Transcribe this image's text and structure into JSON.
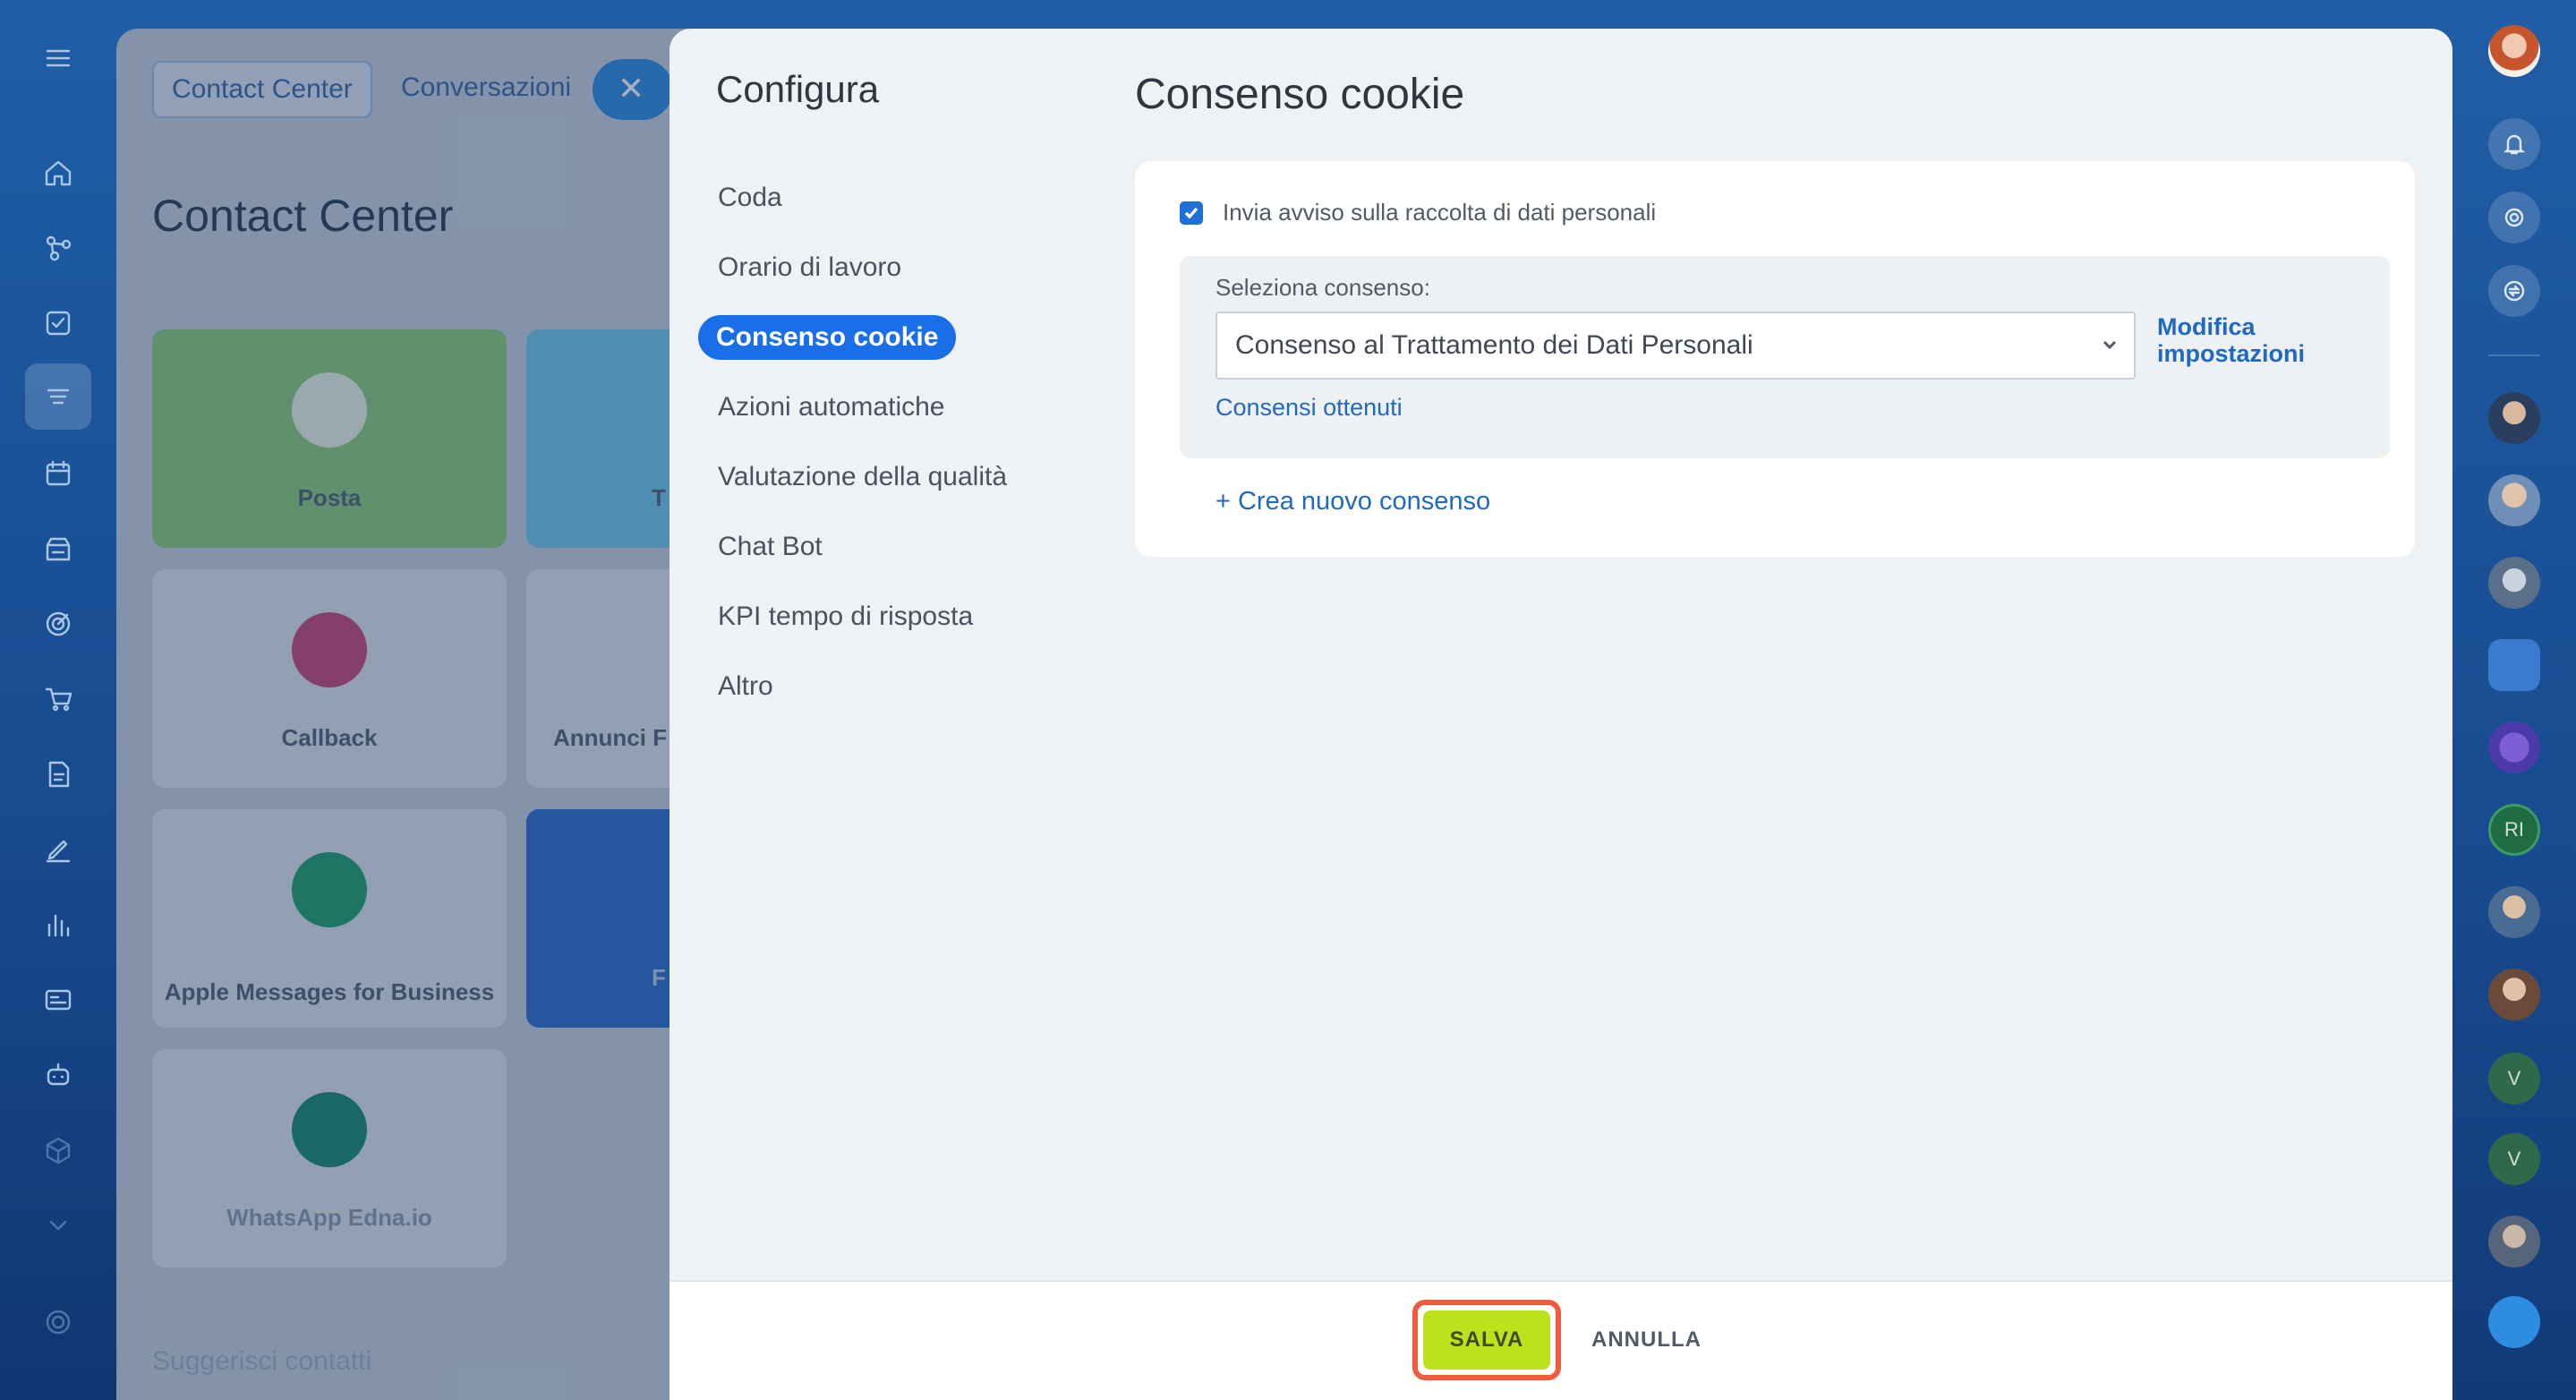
{
  "background_page": {
    "tabs": [
      "Contact Center",
      "Conversazioni"
    ],
    "close_label": "✕",
    "title": "Contact Center",
    "cards": [
      "Posta",
      "T",
      "Callback",
      "Annunci F",
      "Apple Messages for Business",
      "F",
      "WhatsApp Edna.io"
    ],
    "footer_text": "Suggerisci contatti"
  },
  "sidebar": {
    "title": "Configura",
    "items": [
      {
        "label": "Coda"
      },
      {
        "label": "Orario di lavoro"
      },
      {
        "label": "Consenso cookie",
        "active": true
      },
      {
        "label": "Azioni automatiche"
      },
      {
        "label": "Valutazione della qualità"
      },
      {
        "label": "Chat Bot"
      },
      {
        "label": "KPI tempo di risposta"
      },
      {
        "label": "Altro"
      }
    ]
  },
  "main": {
    "title": "Consenso cookie",
    "checkbox_label": "Invia avviso sulla raccolta di dati personali",
    "checkbox_checked": true,
    "select_label": "Seleziona consenso:",
    "select_value": "Consenso al Trattamento dei Dati Personali",
    "modify_label": "Modifica impostazioni",
    "obtained_link": "Consensi ottenuti",
    "new_consent_link": "+ Crea nuovo consenso"
  },
  "footer": {
    "save_label": "SALVA",
    "cancel_label": "ANNULLA"
  },
  "right_rail": {
    "avatar_initials": [
      "RI",
      "V",
      "V"
    ]
  },
  "colors": {
    "accent_blue": "#1a6fe8",
    "save_green": "#bde21b",
    "highlight_red": "#ef5b3f",
    "link_blue": "#1f6ac0"
  }
}
